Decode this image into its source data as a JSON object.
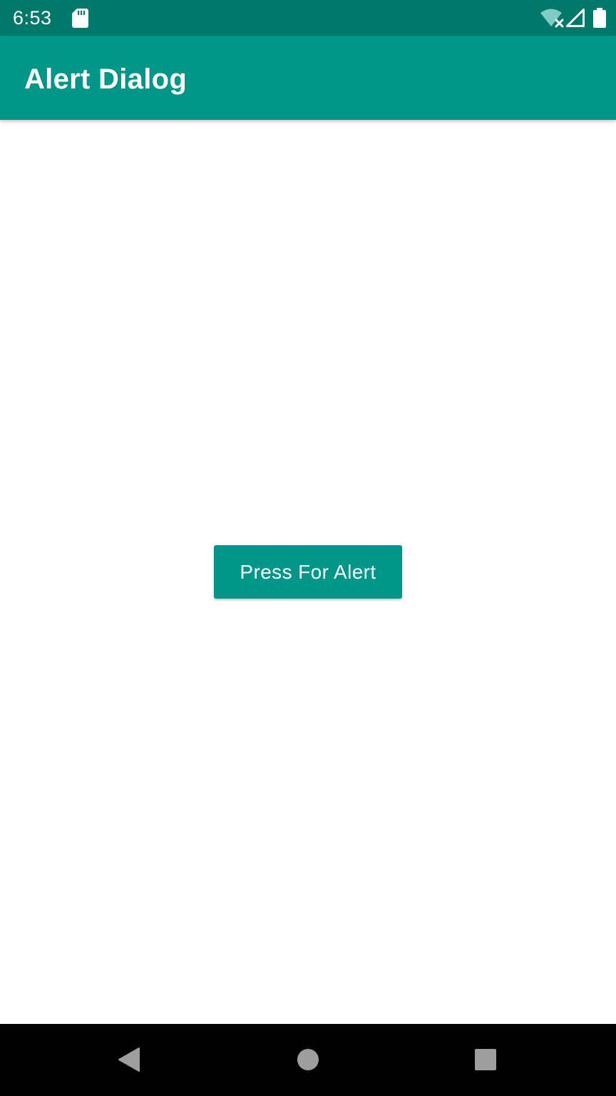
{
  "status_bar": {
    "time": "6:53",
    "icons": [
      "sd-card-icon",
      "wifi-off-icon",
      "signal-icon",
      "battery-icon"
    ]
  },
  "app_bar": {
    "title": "Alert Dialog"
  },
  "main": {
    "alert_button_label": "Press For Alert"
  },
  "nav_bar": {
    "icons": [
      "back-icon",
      "home-icon",
      "recents-icon"
    ]
  },
  "colors": {
    "status_bar": "#00796b",
    "app_bar": "#009688",
    "button": "#009688",
    "background": "#ffffff",
    "nav_bar": "#000000",
    "nav_icons": "#9e9e9e"
  }
}
